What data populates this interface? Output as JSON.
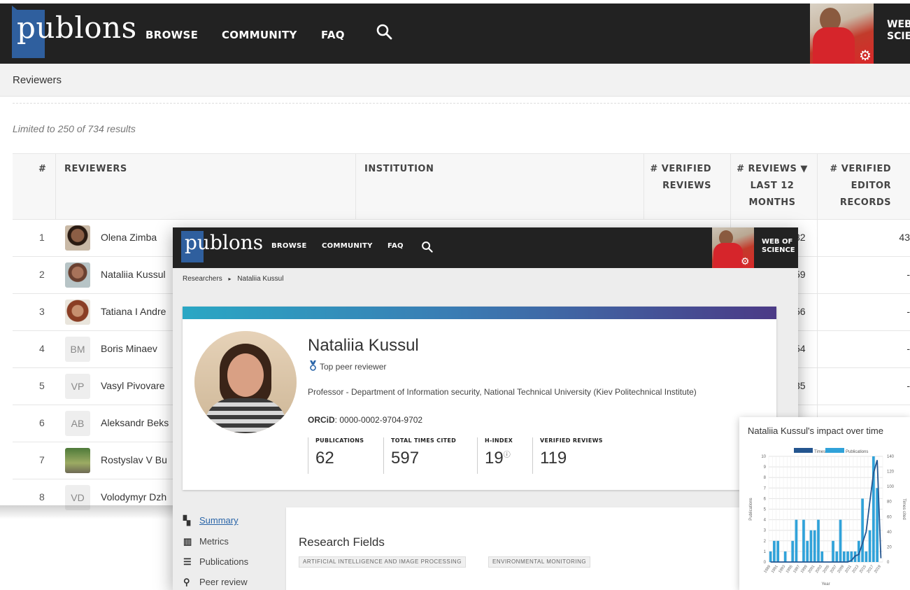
{
  "bg": {
    "logo": "publons",
    "nav": [
      "BROWSE",
      "COMMUNITY",
      "FAQ"
    ],
    "wos_lines": [
      "WEB",
      "SCIE"
    ],
    "subbar": "Reviewers",
    "limited": "Limited to 250 of 734 results",
    "headers": {
      "num": "#",
      "reviewers": "REVIEWERS",
      "institution": "INSTITUTION",
      "verified_reviews": [
        "# VERIFIED",
        "REVIEWS"
      ],
      "reviews_last": [
        "# REVIEWS ▼",
        "LAST 12",
        "MONTHS"
      ],
      "editor_records": [
        "# VERIFIED",
        "EDITOR",
        "RECORDS"
      ]
    },
    "rows": [
      {
        "num": "1",
        "name": "Olena Zimba",
        "initials": "",
        "reviews_partial": "32",
        "editor": "43"
      },
      {
        "num": "2",
        "name": "Nataliia Kussul",
        "initials": "",
        "reviews_partial": "59",
        "editor": "-"
      },
      {
        "num": "3",
        "name": "Tatiana I Andre",
        "initials": "",
        "reviews_partial": "56",
        "editor": "-"
      },
      {
        "num": "4",
        "name": "Boris Minaev",
        "initials": "BM",
        "reviews_partial": "54",
        "editor": "-"
      },
      {
        "num": "5",
        "name": "Vasyl Pivovare",
        "initials": "VP",
        "reviews_partial": "35",
        "editor": "-"
      },
      {
        "num": "6",
        "name": "Aleksandr Beks",
        "initials": "AB",
        "reviews_partial": "",
        "editor": ""
      },
      {
        "num": "7",
        "name": "Rostyslav V Bu",
        "initials": "",
        "reviews_partial": "",
        "editor": ""
      },
      {
        "num": "8",
        "name": "Volodymyr Dzh",
        "initials": "VD",
        "reviews_partial": "",
        "editor": ""
      }
    ]
  },
  "fg": {
    "logo": "publons",
    "nav": [
      "BROWSE",
      "COMMUNITY",
      "FAQ"
    ],
    "wos_lines": [
      "WEB OF",
      "SCIENCE"
    ],
    "breadcrumb": {
      "root": "Researchers",
      "sep": "▸",
      "current": "Nataliia Kussul"
    },
    "name": "Nataliia Kussul",
    "badge": "Top peer reviewer",
    "institution": "Professor - Department of Information security, National Technical University (Kiev Politechnical Institute)",
    "orcid_label": "ORCiD",
    "orcid_value": ": 0000-0002-9704-9702",
    "stats": [
      {
        "label": "PUBLICATIONS",
        "value": "62"
      },
      {
        "label": "TOTAL TIMES CITED",
        "value": "597"
      },
      {
        "label": "H-INDEX",
        "value": "19"
      },
      {
        "label": "VERIFIED REVIEWS",
        "value": "119"
      }
    ],
    "sidebar": [
      "Summary",
      "Metrics",
      "Publications",
      "Peer review"
    ],
    "research_title": "Research Fields",
    "tags": [
      "ARTIFICIAL INTELLIGENCE AND IMAGE PROCESSING",
      "ENVIRONMENTAL MONITORING"
    ]
  },
  "chart_title": "Nataliia Kussul's impact over time",
  "chart_data": {
    "type": "bar",
    "title": "Nataliia Kussul's impact over time",
    "xlabel": "Year",
    "ylabel": "Publications",
    "y2label": "Times cited",
    "legend": [
      "Times Cited",
      "Publications"
    ],
    "legend_position": "top",
    "categories": [
      "1989",
      "1990",
      "1991",
      "1992",
      "1993",
      "1994",
      "1995",
      "1996",
      "1997",
      "1998",
      "1999",
      "2000",
      "2001",
      "2002",
      "2003",
      "2004",
      "2005",
      "2006",
      "2007",
      "2008",
      "2009",
      "2010",
      "2011",
      "2012",
      "2013",
      "2014",
      "2015",
      "2016",
      "2017",
      "2018",
      "2019"
    ],
    "x_tick_labels": [
      "1989",
      "1991",
      "1993",
      "1995",
      "1997",
      "1999",
      "2001",
      "2003",
      "2005",
      "2007",
      "2009",
      "2011",
      "2013",
      "2015",
      "2017",
      "2019"
    ],
    "series": [
      {
        "name": "Publications",
        "axis": "left",
        "values": [
          1,
          2,
          2,
          0,
          1,
          0,
          2,
          4,
          0,
          4,
          2,
          3,
          3,
          4,
          1,
          0,
          0,
          2,
          1,
          4,
          1,
          1,
          1,
          1,
          2,
          6,
          1,
          3,
          10,
          7,
          0
        ]
      },
      {
        "name": "Times Cited",
        "axis": "right",
        "values": [
          0,
          0,
          0,
          0,
          0,
          0,
          0,
          0,
          0,
          0,
          0,
          0,
          0,
          0,
          0,
          0,
          0,
          0,
          0,
          0,
          0,
          0,
          2,
          8,
          10,
          25,
          40,
          80,
          118,
          135,
          5
        ]
      }
    ],
    "ylim": [
      0,
      10
    ],
    "y_ticks": [
      0,
      1,
      2,
      3,
      4,
      5,
      6,
      7,
      8,
      9,
      10
    ],
    "y2lim": [
      0,
      140
    ],
    "y2_ticks": [
      0,
      20,
      40,
      60,
      80,
      100,
      120,
      140
    ],
    "grid": true,
    "colors": {
      "publications": "#30a2d9",
      "times_cited": "#24558f"
    }
  }
}
